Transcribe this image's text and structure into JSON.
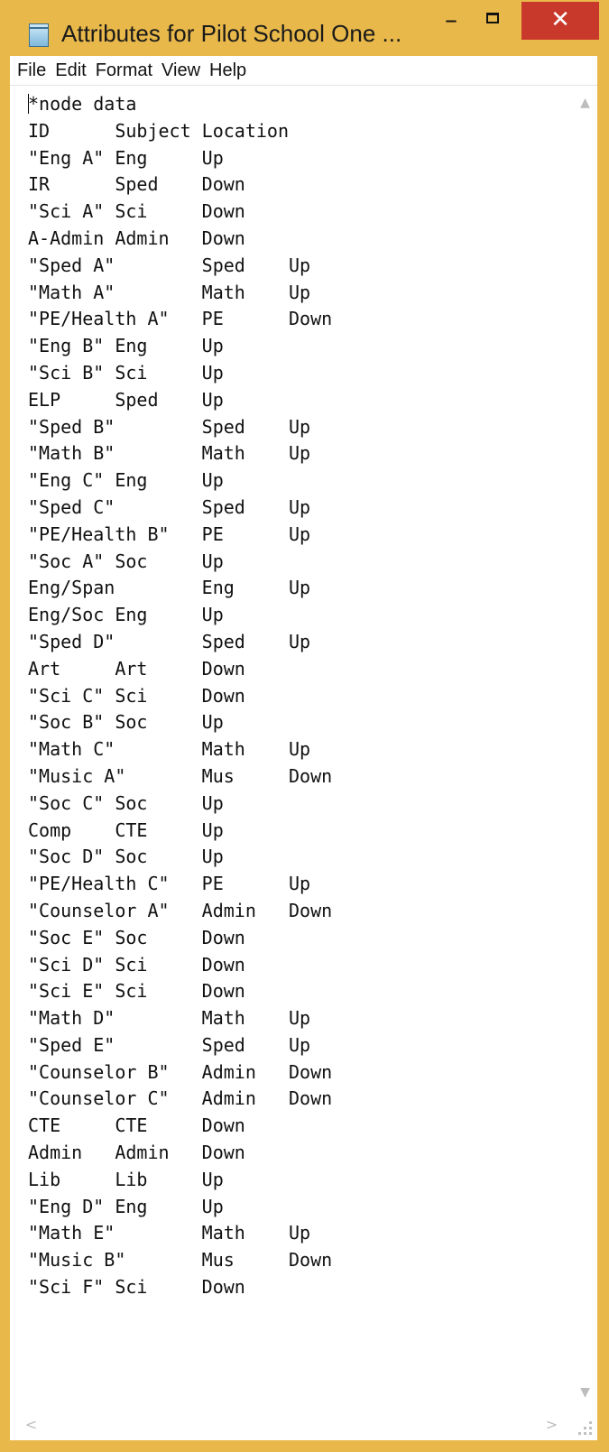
{
  "window": {
    "title": "Attributes for Pilot School One ...",
    "controls": {
      "minimize": "–",
      "close": "✕"
    }
  },
  "menu": [
    "File",
    "Edit",
    "Format",
    "View",
    "Help"
  ],
  "document": {
    "lines": [
      "*node data",
      "ID      Subject Location",
      "\"Eng A\" Eng     Up",
      "IR      Sped    Down",
      "\"Sci A\" Sci     Down",
      "A-Admin Admin   Down",
      "\"Sped A\"        Sped    Up",
      "\"Math A\"        Math    Up",
      "\"PE/Health A\"   PE      Down",
      "\"Eng B\" Eng     Up",
      "\"Sci B\" Sci     Up",
      "ELP     Sped    Up",
      "\"Sped B\"        Sped    Up",
      "\"Math B\"        Math    Up",
      "\"Eng C\" Eng     Up",
      "\"Sped C\"        Sped    Up",
      "\"PE/Health B\"   PE      Up",
      "\"Soc A\" Soc     Up",
      "Eng/Span        Eng     Up",
      "Eng/Soc Eng     Up",
      "\"Sped D\"        Sped    Up",
      "Art     Art     Down",
      "\"Sci C\" Sci     Down",
      "\"Soc B\" Soc     Up",
      "\"Math C\"        Math    Up",
      "\"Music A\"       Mus     Down",
      "\"Soc C\" Soc     Up",
      "Comp    CTE     Up",
      "\"Soc D\" Soc     Up",
      "\"PE/Health C\"   PE      Up",
      "\"Counselor A\"   Admin   Down",
      "\"Soc E\" Soc     Down",
      "\"Sci D\" Sci     Down",
      "\"Sci E\" Sci     Down",
      "\"Math D\"        Math    Up",
      "\"Sped E\"        Sped    Up",
      "\"Counselor B\"   Admin   Down",
      "\"Counselor C\"   Admin   Down",
      "CTE     CTE     Down",
      "Admin   Admin   Down",
      "Lib     Lib     Up",
      "\"Eng D\" Eng     Up",
      "\"Math E\"        Math    Up",
      "\"Music B\"       Mus     Down",
      "\"Sci F\" Sci     Down"
    ]
  },
  "scrollbars": {
    "up": "▲",
    "down": "▼",
    "left": "<",
    "right": ">"
  }
}
